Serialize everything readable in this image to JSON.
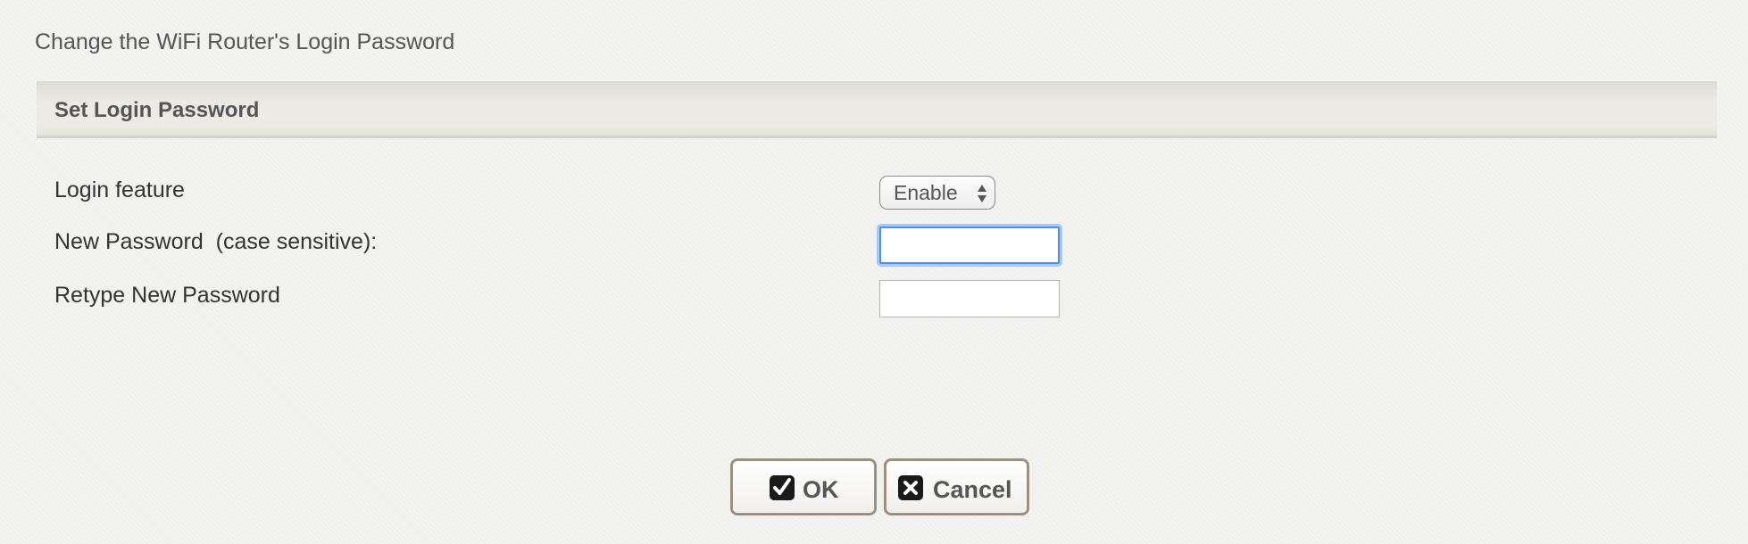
{
  "page": {
    "title": "Change the WiFi Router's Login Password"
  },
  "section": {
    "title": "Set Login Password"
  },
  "fields": {
    "login_feature": {
      "label": "Login feature",
      "value": "Enable"
    },
    "new_password": {
      "label": "New Password  (case sensitive):",
      "value": ""
    },
    "retype_password": {
      "label": "Retype New Password",
      "value": ""
    }
  },
  "buttons": {
    "ok_label": "OK",
    "cancel_label": "Cancel"
  },
  "icons": {
    "ok": "checkmark-icon",
    "cancel": "close-icon",
    "select": "updown-arrows-icon"
  },
  "colors": {
    "focus_ring": "#4f8ee8",
    "button_border": "#9e907c",
    "header_bg": "#eceae4"
  }
}
